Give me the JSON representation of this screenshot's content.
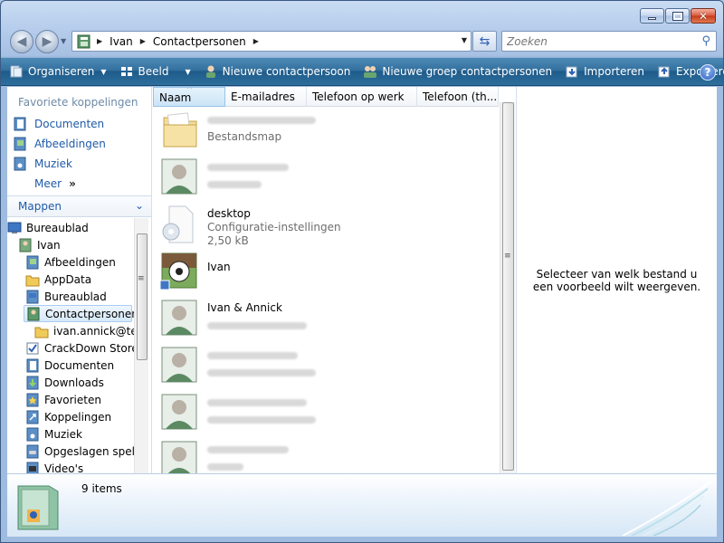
{
  "address": {
    "crumbs": [
      "Ivan",
      "Contactpersonen"
    ]
  },
  "search": {
    "placeholder": "Zoeken"
  },
  "toolbar": {
    "organize": "Organiseren",
    "view": "Beeld",
    "new_contact": "Nieuwe contactpersoon",
    "new_group": "Nieuwe groep contactpersonen",
    "import": "Importeren",
    "export": "Exporteren"
  },
  "navpane": {
    "favorites_title": "Favoriete koppelingen",
    "favorites": [
      "Documenten",
      "Afbeeldingen",
      "Muziek"
    ],
    "more": "Meer",
    "folders_title": "Mappen",
    "tree": [
      {
        "label": "Bureaublad",
        "level": 0,
        "icon": "desktop-icon"
      },
      {
        "label": "Ivan",
        "level": 1,
        "icon": "user-folder-icon"
      },
      {
        "label": "Afbeeldingen",
        "level": 2,
        "icon": "pictures-folder-icon"
      },
      {
        "label": "AppData",
        "level": 2,
        "icon": "folder-icon"
      },
      {
        "label": "Bureaublad",
        "level": 2,
        "icon": "desktop-folder-icon"
      },
      {
        "label": "Contactpersonen",
        "level": 2,
        "icon": "contacts-folder-icon",
        "selected": true
      },
      {
        "label": "ivan.annick@tele",
        "level": 3,
        "icon": "folder-icon"
      },
      {
        "label": "CrackDown Store",
        "level": 2,
        "icon": "checkbox-folder-icon"
      },
      {
        "label": "Documenten",
        "level": 2,
        "icon": "documents-folder-icon"
      },
      {
        "label": "Downloads",
        "level": 2,
        "icon": "downloads-folder-icon"
      },
      {
        "label": "Favorieten",
        "level": 2,
        "icon": "favorites-folder-icon"
      },
      {
        "label": "Koppelingen",
        "level": 2,
        "icon": "links-folder-icon"
      },
      {
        "label": "Muziek",
        "level": 2,
        "icon": "music-folder-icon"
      },
      {
        "label": "Opgeslagen spelle",
        "level": 2,
        "icon": "games-folder-icon"
      },
      {
        "label": "Video's",
        "level": 2,
        "icon": "videos-folder-icon"
      }
    ]
  },
  "columns": [
    "Naam",
    "E-mailadres",
    "Telefoon op werk",
    "Telefoon (th..."
  ],
  "files": [
    {
      "name": "",
      "sub": "Bestandsmap",
      "sub2": "",
      "type": "folder"
    },
    {
      "name": "",
      "sub": "",
      "sub2": "",
      "type": "contact"
    },
    {
      "name": "desktop",
      "sub": "Configuratie-instellingen",
      "sub2": "2,50 kB",
      "type": "settings"
    },
    {
      "name": "Ivan",
      "sub": "",
      "sub2": "",
      "type": "contact-photo"
    },
    {
      "name": "Ivan & Annick",
      "sub": "",
      "sub2": "",
      "type": "contact"
    },
    {
      "name": "",
      "sub": "",
      "sub2": "",
      "type": "contact"
    },
    {
      "name": "",
      "sub": "",
      "sub2": "",
      "type": "contact"
    },
    {
      "name": "",
      "sub": "",
      "sub2": "",
      "type": "contact"
    }
  ],
  "preview": {
    "message": "Selecteer van welk bestand u een voorbeeld wilt weergeven."
  },
  "details": {
    "count": "9 items"
  },
  "colors": {
    "accent": "#1e5aa8",
    "cmdbar": "#2d6f9c"
  }
}
